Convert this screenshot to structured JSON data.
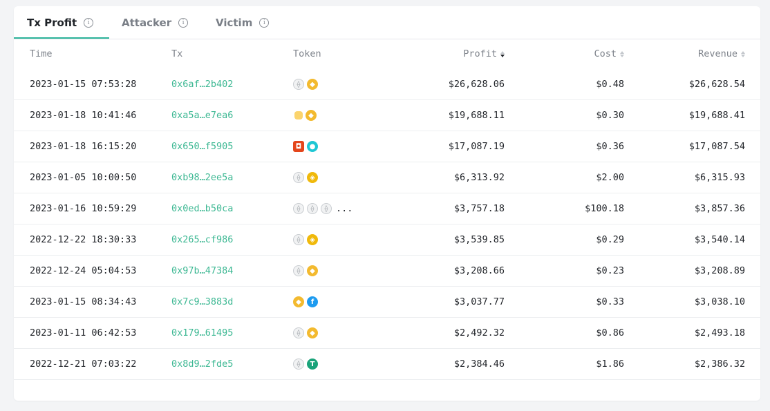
{
  "tabs": [
    {
      "label": "Tx Profit",
      "active": true
    },
    {
      "label": "Attacker",
      "active": false
    },
    {
      "label": "Victim",
      "active": false
    }
  ],
  "columns": {
    "time": "Time",
    "tx": "Tx",
    "token": "Token",
    "profit": "Profit",
    "cost": "Cost",
    "revenue": "Revenue"
  },
  "sort": {
    "column": "profit",
    "direction": "desc"
  },
  "rows": [
    {
      "time": "2023-01-15 07:53:28",
      "tx": "0x6af…2b402",
      "tokens": [
        "eth-icon",
        "bnb-icon"
      ],
      "more": "",
      "profit": "$26,628.06",
      "cost": "$0.48",
      "revenue": "$26,628.54"
    },
    {
      "time": "2023-01-18 10:41:46",
      "tx": "0xa5a…e7ea6",
      "tokens": [
        "cake-icon",
        "bnb-icon"
      ],
      "more": "",
      "profit": "$19,688.11",
      "cost": "$0.30",
      "revenue": "$19,688.41"
    },
    {
      "time": "2023-01-18 16:15:20",
      "tx": "0x650…f5905",
      "tokens": [
        "shield-token-icon",
        "bunny-token-icon"
      ],
      "more": "",
      "profit": "$17,087.19",
      "cost": "$0.36",
      "revenue": "$17,087.54"
    },
    {
      "time": "2023-01-05 10:00:50",
      "tx": "0xb98…2ee5a",
      "tokens": [
        "eth-icon",
        "busd-icon"
      ],
      "more": "",
      "profit": "$6,313.92",
      "cost": "$2.00",
      "revenue": "$6,315.93"
    },
    {
      "time": "2023-01-16 10:59:29",
      "tx": "0x0ed…b50ca",
      "tokens": [
        "eth-icon",
        "eth-icon",
        "eth-icon"
      ],
      "more": "...",
      "profit": "$3,757.18",
      "cost": "$100.18",
      "revenue": "$3,857.36"
    },
    {
      "time": "2022-12-22 18:30:33",
      "tx": "0x265…cf986",
      "tokens": [
        "eth-icon",
        "busd-icon"
      ],
      "more": "",
      "profit": "$3,539.85",
      "cost": "$0.29",
      "revenue": "$3,540.14"
    },
    {
      "time": "2022-12-24 05:04:53",
      "tx": "0x97b…47384",
      "tokens": [
        "eth-icon",
        "bnb-icon"
      ],
      "more": "",
      "profit": "$3,208.66",
      "cost": "$0.23",
      "revenue": "$3,208.89"
    },
    {
      "time": "2023-01-15 08:34:43",
      "tx": "0x7c9…3883d",
      "tokens": [
        "bnb-icon",
        "fet-icon"
      ],
      "more": "",
      "profit": "$3,037.77",
      "cost": "$0.33",
      "revenue": "$3,038.10"
    },
    {
      "time": "2023-01-11 06:42:53",
      "tx": "0x179…61495",
      "tokens": [
        "eth-icon",
        "bnb-icon"
      ],
      "more": "",
      "profit": "$2,492.32",
      "cost": "$0.86",
      "revenue": "$2,493.18"
    },
    {
      "time": "2022-12-21 07:03:22",
      "tx": "0x8d9…2fde5",
      "tokens": [
        "eth-icon",
        "usdt-icon"
      ],
      "more": "",
      "profit": "$2,384.46",
      "cost": "$1.86",
      "revenue": "$2,386.32"
    }
  ]
}
